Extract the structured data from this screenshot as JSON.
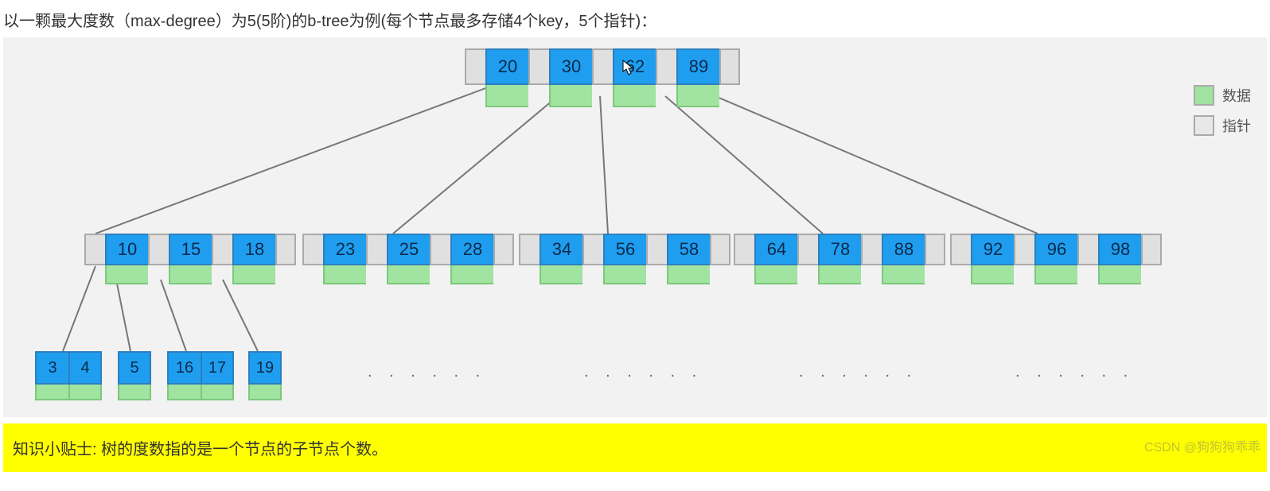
{
  "top_text": "以一颗最大度数（max-degree）为5(5阶)的b-tree为例(每个节点最多存储4个key，5个指针)：",
  "legend": {
    "data_label": "数据",
    "pointer_label": "指针"
  },
  "tip": "知识小贴士: 树的度数指的是一个节点的子节点个数。",
  "watermark": "CSDN @狗狗狗乖乖",
  "dots": ". . . . . .",
  "chart_data": {
    "type": "tree",
    "title": "B-tree (max-degree 5)",
    "max_degree": 5,
    "max_keys_per_node": 4,
    "max_pointers_per_node": 5,
    "root": {
      "keys": [
        20,
        30,
        62,
        89
      ]
    },
    "level2": [
      {
        "keys": [
          10,
          15,
          18
        ]
      },
      {
        "keys": [
          23,
          25,
          28
        ]
      },
      {
        "keys": [
          34,
          56,
          58
        ]
      },
      {
        "keys": [
          64,
          78,
          88
        ]
      },
      {
        "keys": [
          92,
          96,
          98
        ]
      }
    ],
    "level3_first_child": [
      {
        "keys": [
          3,
          4
        ]
      },
      {
        "keys": [
          5
        ]
      },
      {
        "keys": [
          16,
          17
        ]
      },
      {
        "keys": [
          19
        ]
      }
    ],
    "level3_others_ellipsis": true
  },
  "root": {
    "k0": "20",
    "k1": "30",
    "k2": "62",
    "k3": "89"
  },
  "l2": {
    "n0": {
      "k0": "10",
      "k1": "15",
      "k2": "18"
    },
    "n1": {
      "k0": "23",
      "k1": "25",
      "k2": "28"
    },
    "n2": {
      "k0": "34",
      "k1": "56",
      "k2": "58"
    },
    "n3": {
      "k0": "64",
      "k1": "78",
      "k2": "88"
    },
    "n4": {
      "k0": "92",
      "k1": "96",
      "k2": "98"
    }
  },
  "l3": {
    "n0": {
      "k0": "3",
      "k1": "4"
    },
    "n1": {
      "k0": "5"
    },
    "n2": {
      "k0": "16",
      "k1": "17"
    },
    "n3": {
      "k0": "19"
    }
  }
}
